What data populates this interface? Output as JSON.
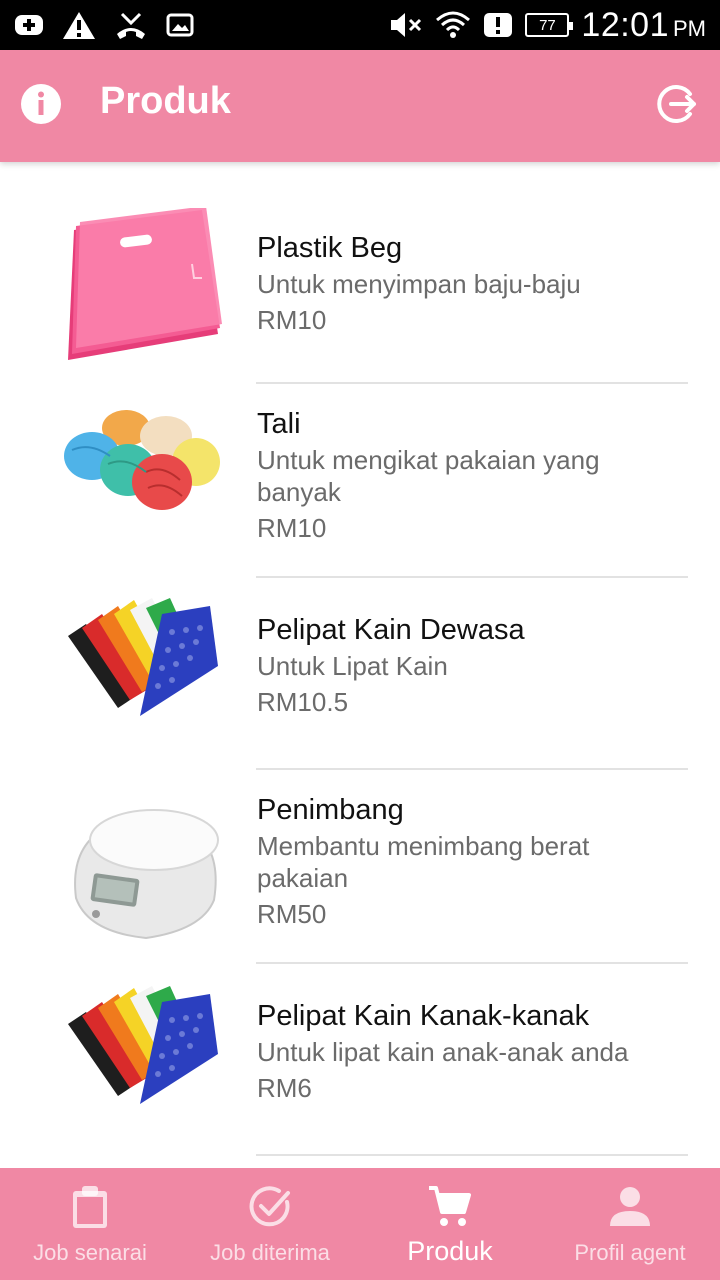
{
  "status_bar": {
    "time": "12:01",
    "ampm": "PM",
    "battery": "77"
  },
  "app_bar": {
    "title": "Produk"
  },
  "products": [
    {
      "name": "Plastik Beg",
      "description": "Untuk menyimpan baju-baju",
      "price": "RM10"
    },
    {
      "name": "Tali",
      "description": "Untuk mengikat pakaian yang banyak",
      "price": "RM10"
    },
    {
      "name": "Pelipat Kain Dewasa",
      "description": "Untuk Lipat Kain",
      "price": "RM10.5"
    },
    {
      "name": "Penimbang",
      "description": "Membantu menimbang berat pakaian",
      "price": "RM50"
    },
    {
      "name": "Pelipat Kain Kanak-kanak",
      "description": "Untuk lipat kain anak-anak anda",
      "price": "RM6"
    }
  ],
  "bottom_nav": [
    {
      "label": "Job senarai",
      "icon": "clipboard-icon"
    },
    {
      "label": "Job diterima",
      "icon": "check-circle-icon"
    },
    {
      "label": "Produk",
      "icon": "cart-icon",
      "active": true
    },
    {
      "label": "Profil agent",
      "icon": "person-icon"
    }
  ],
  "colors": {
    "accent": "#f088a4",
    "status_bar": "#000000"
  }
}
